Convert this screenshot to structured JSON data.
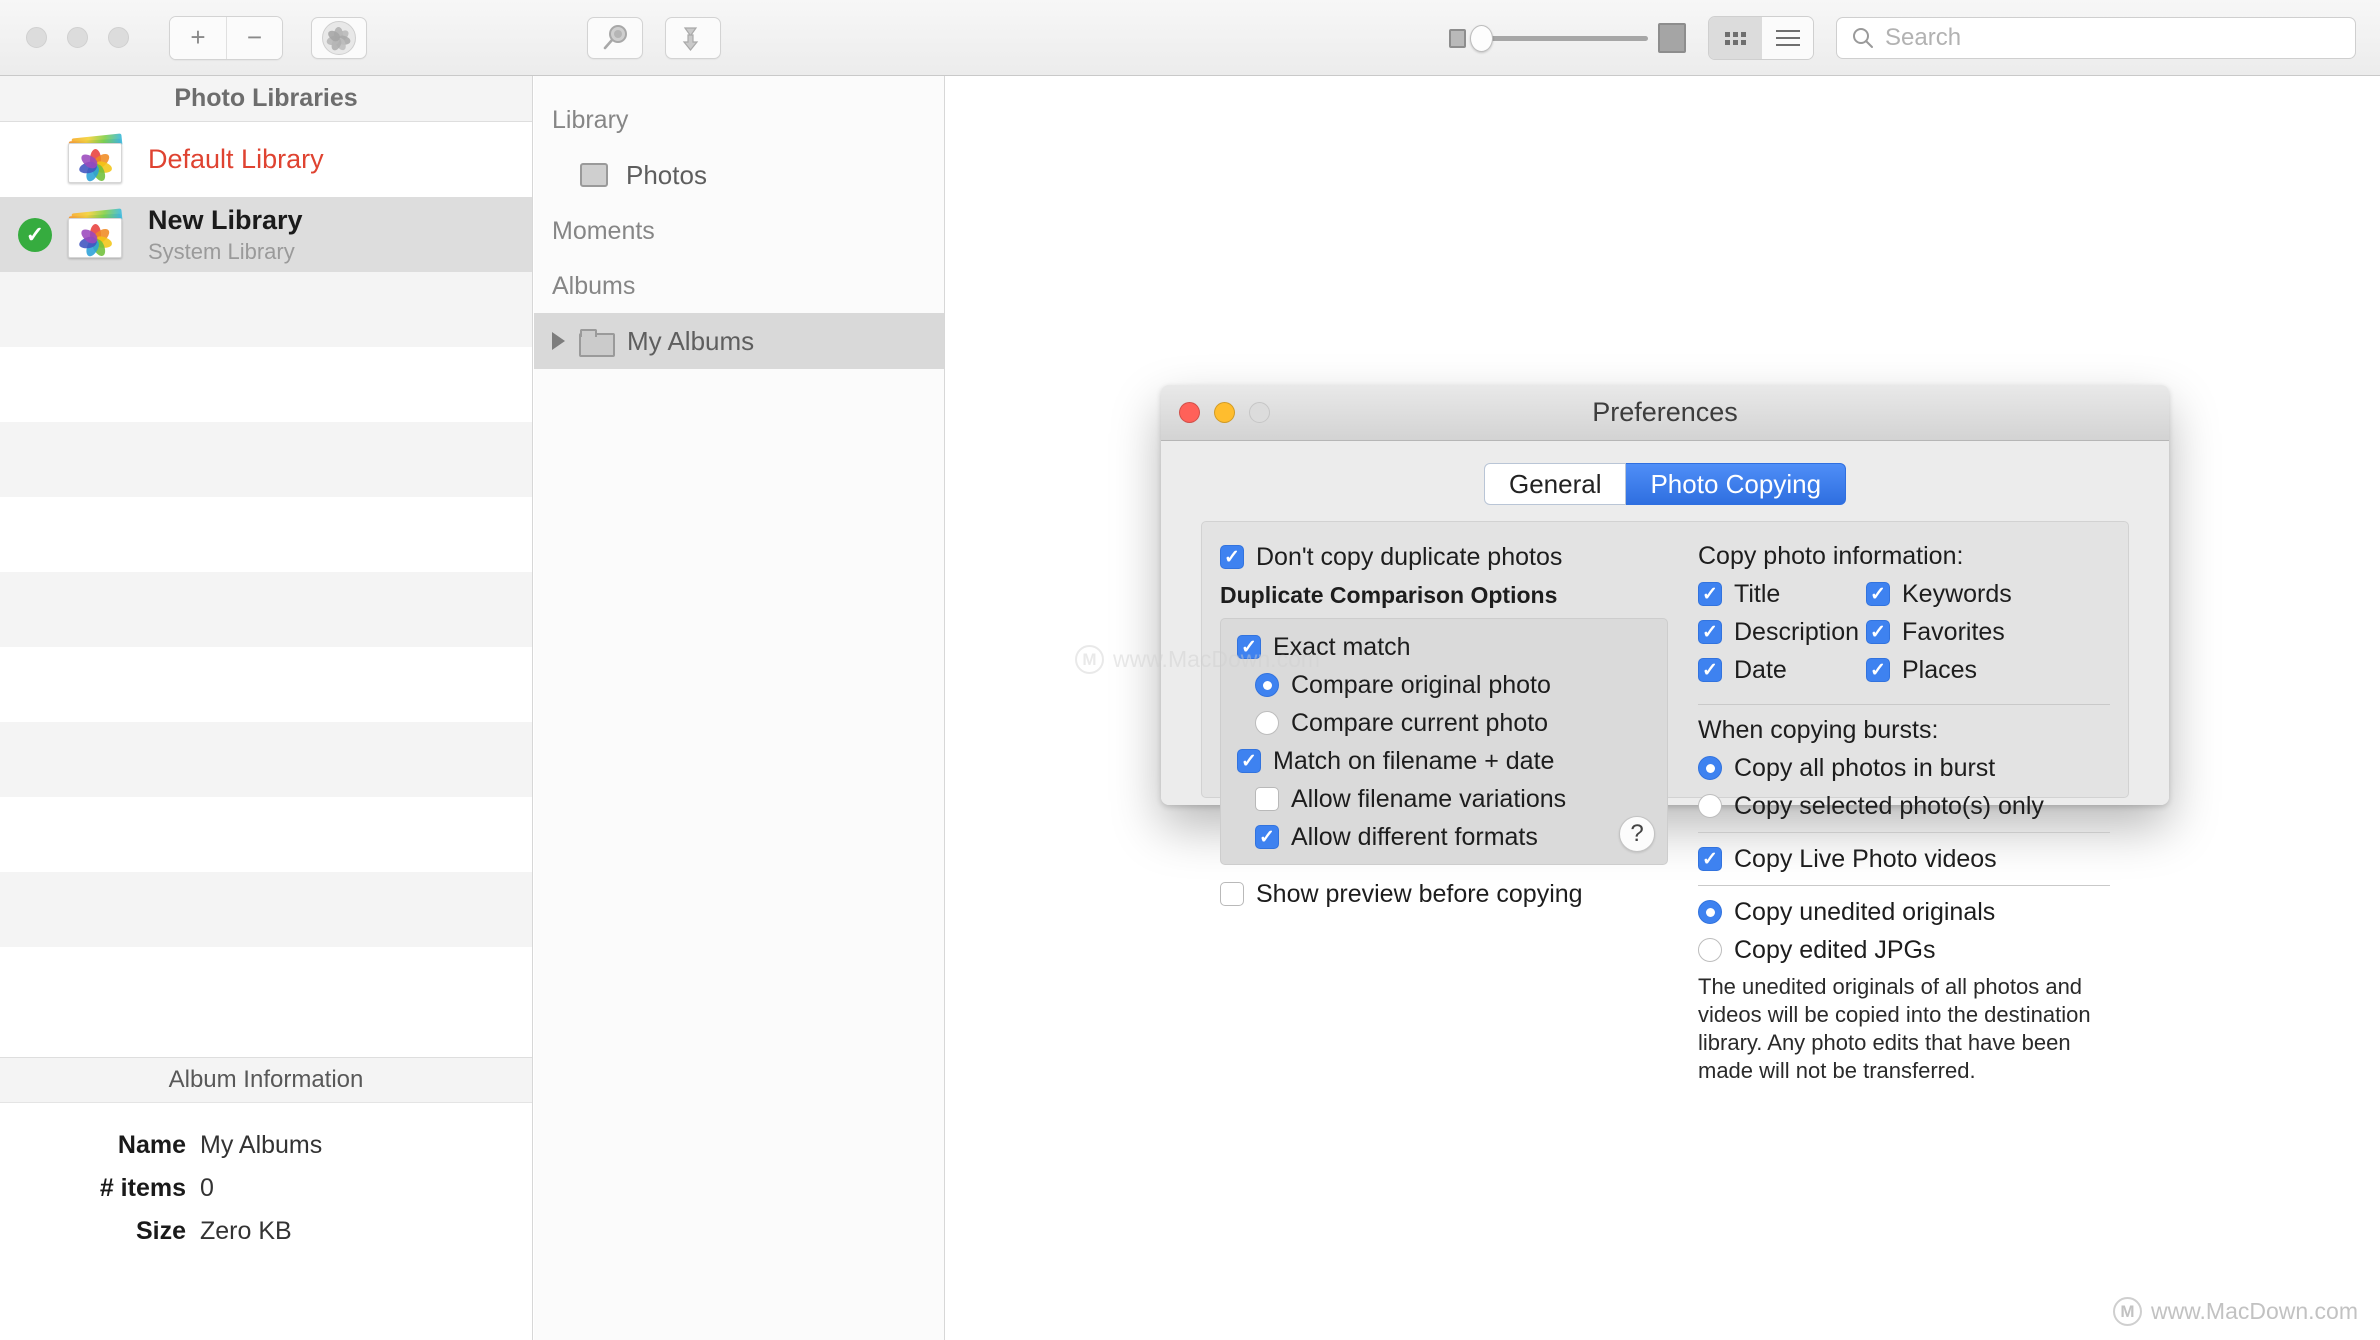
{
  "toolbar": {
    "traffic_lights": [
      "close",
      "minimize",
      "zoom"
    ],
    "add_label": "+",
    "remove_label": "−",
    "gear_icon": "photos-app-icon",
    "browse_icon": "magnifier-icon",
    "merge_icon": "download-arrow-icon",
    "zoom_slider": {
      "min_icon": "small-photo-icon",
      "max_icon": "large-photo-icon",
      "value": 0
    },
    "view_grid_icon": "grid-view-icon",
    "view_list_icon": "list-view-icon",
    "active_view": "grid",
    "search": {
      "placeholder": "Search",
      "value": "",
      "icon": "search-icon"
    }
  },
  "sidebar": {
    "header": "Photo Libraries",
    "libraries": [
      {
        "name": "Default Library",
        "subtitle": "",
        "active": false,
        "style": "red"
      },
      {
        "name": "New Library",
        "subtitle": "System Library",
        "active": true,
        "style": "bold"
      }
    ],
    "album_information": {
      "header": "Album Information",
      "rows": [
        {
          "label": "Name",
          "value": "My Albums"
        },
        {
          "label": "# items",
          "value": "0"
        },
        {
          "label": "Size",
          "value": "Zero KB"
        }
      ]
    }
  },
  "panel2": {
    "groups": [
      {
        "title": "Library",
        "items": [
          {
            "label": "Photos",
            "icon": "photos-thumbnail-icon",
            "selected": false
          }
        ]
      },
      {
        "title": "Moments",
        "items": []
      },
      {
        "title": "Albums",
        "items": [
          {
            "label": "My Albums",
            "icon": "folder-icon",
            "selected": true,
            "expandable": true
          }
        ]
      }
    ]
  },
  "preferences": {
    "title": "Preferences",
    "tabs": [
      {
        "label": "General",
        "active": false
      },
      {
        "label": "Photo Copying",
        "active": true
      }
    ],
    "left": {
      "dont_copy_duplicates": {
        "label": "Don't copy duplicate photos",
        "checked": true
      },
      "dup_options_title": "Duplicate Comparison Options",
      "exact_match": {
        "label": "Exact match",
        "checked": true
      },
      "compare_original": {
        "label": "Compare original photo",
        "selected": true
      },
      "compare_current": {
        "label": "Compare current photo",
        "selected": false
      },
      "match_filename_date": {
        "label": "Match on filename + date",
        "checked": true
      },
      "allow_filename_variations": {
        "label": "Allow filename variations",
        "checked": false
      },
      "allow_different_formats": {
        "label": "Allow different formats",
        "checked": true
      },
      "help_label": "?",
      "show_preview": {
        "label": "Show preview before copying",
        "checked": false
      }
    },
    "right": {
      "copy_info_title": "Copy photo information:",
      "copy_info": [
        {
          "label": "Title",
          "checked": true
        },
        {
          "label": "Keywords",
          "checked": true
        },
        {
          "label": "Description",
          "checked": true
        },
        {
          "label": "Favorites",
          "checked": true
        },
        {
          "label": "Date",
          "checked": true
        },
        {
          "label": "Places",
          "checked": true
        }
      ],
      "bursts_title": "When copying bursts:",
      "burst_all": {
        "label": "Copy all photos in burst",
        "selected": true
      },
      "burst_selected": {
        "label": "Copy selected photo(s) only",
        "selected": false
      },
      "copy_live_videos": {
        "label": "Copy Live Photo videos",
        "checked": true
      },
      "copy_unedited": {
        "label": "Copy unedited originals",
        "selected": true
      },
      "copy_edited_jpgs": {
        "label": "Copy edited JPGs",
        "selected": false
      },
      "description": "The unedited originals of all photos and videos will be copied into the destination library. Any photo edits that have been made will not be transferred."
    }
  },
  "watermark": {
    "text": "www.MacDown.com",
    "logo": "M"
  },
  "colors": {
    "accent_blue": "#3e82f0",
    "tab_blue": "#2f6fe0",
    "library_red": "#df4331",
    "active_green": "#36ac3f"
  }
}
